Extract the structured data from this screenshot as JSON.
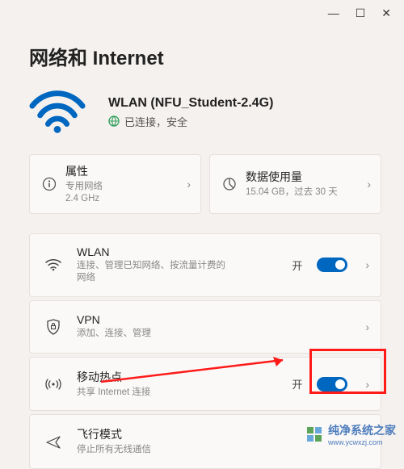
{
  "titlebar": {
    "min": "—",
    "max": "☐",
    "close": "✕"
  },
  "page_title": "网络和 Internet",
  "wifi_header": {
    "name": "WLAN (NFU_Student-2.4G)",
    "status": "已连接，安全"
  },
  "cards": {
    "properties": {
      "title": "属性",
      "sub": "专用网络\n2.4 GHz"
    },
    "data_usage": {
      "title": "数据使用量",
      "sub": "15.04 GB，过去 30 天"
    }
  },
  "items": {
    "wlan": {
      "title": "WLAN",
      "sub": "连接、管理已知网络、按流量计费的网络",
      "state": "开"
    },
    "vpn": {
      "title": "VPN",
      "sub": "添加、连接、管理"
    },
    "hotspot": {
      "title": "移动热点",
      "sub": "共享 Internet 连接",
      "state": "开"
    },
    "airplane": {
      "title": "飞行模式",
      "sub": "停止所有无线通信"
    }
  },
  "watermark": {
    "brand": "纯净系统之家",
    "url": "www.ycwxzj.com"
  }
}
